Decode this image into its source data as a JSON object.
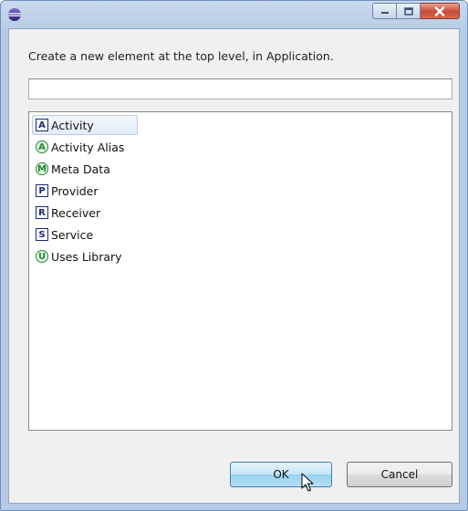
{
  "window": {
    "app_icon": "eclipse-icon",
    "minimize_icon": "minimize-icon",
    "maximize_icon": "maximize-icon",
    "close_icon": "close-icon"
  },
  "dialog": {
    "message": "Create a new element at the top level, in Application.",
    "filter_value": "",
    "items": [
      {
        "badge": "A",
        "shape": "square",
        "label": "Activity",
        "selected": true
      },
      {
        "badge": "A",
        "shape": "circle",
        "label": "Activity Alias",
        "selected": false
      },
      {
        "badge": "M",
        "shape": "circle",
        "label": "Meta Data",
        "selected": false
      },
      {
        "badge": "P",
        "shape": "square",
        "label": "Provider",
        "selected": false
      },
      {
        "badge": "R",
        "shape": "square",
        "label": "Receiver",
        "selected": false
      },
      {
        "badge": "S",
        "shape": "square",
        "label": "Service",
        "selected": false
      },
      {
        "badge": "U",
        "shape": "circle",
        "label": "Uses Library",
        "selected": false
      }
    ],
    "ok_label": "OK",
    "cancel_label": "Cancel"
  },
  "colors": {
    "square_badge": "#1b2a78",
    "circle_badge": "#1c8a2a",
    "selection": "#e2ecf9",
    "ok_button": "#c4e5f6"
  }
}
